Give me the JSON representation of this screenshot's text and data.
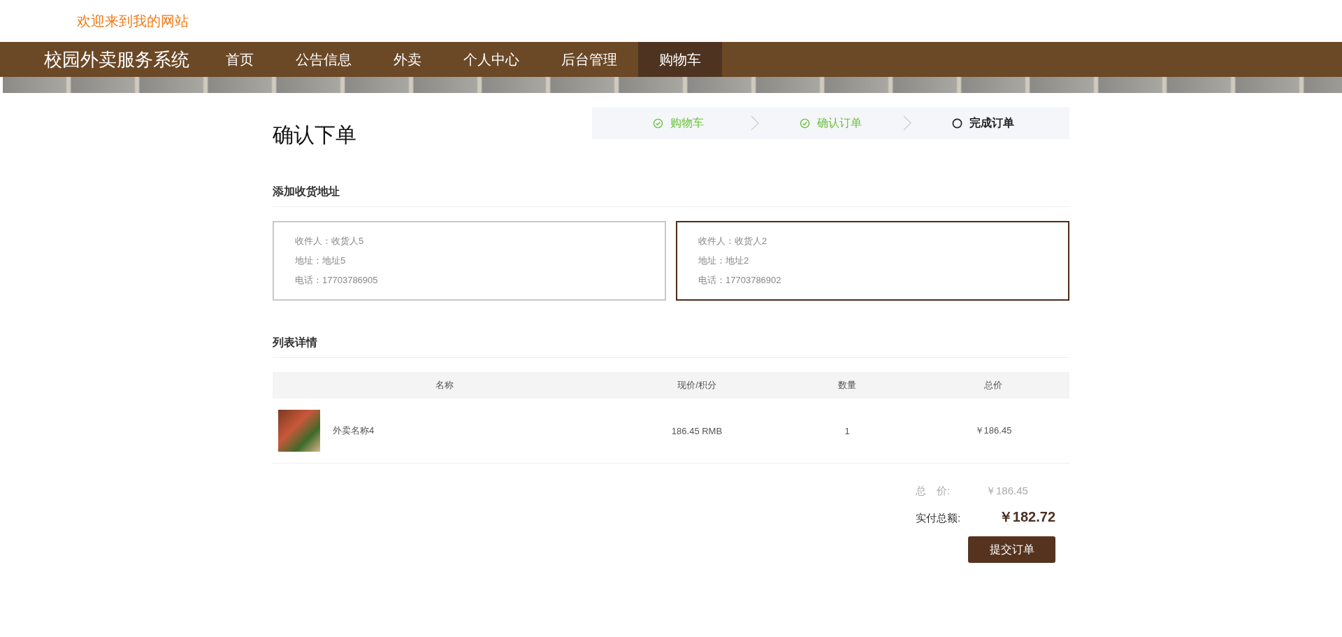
{
  "welcome": "欢迎来到我的网站",
  "nav": {
    "brand": "校园外卖服务系统",
    "items": [
      {
        "label": "首页",
        "selected": false
      },
      {
        "label": "公告信息",
        "selected": false
      },
      {
        "label": "外卖",
        "selected": false
      },
      {
        "label": "个人中心",
        "selected": false
      },
      {
        "label": "后台管理",
        "selected": false
      },
      {
        "label": "购物车",
        "selected": true
      }
    ]
  },
  "page_title": "确认下单",
  "steps": [
    {
      "label": "购物车",
      "done": true
    },
    {
      "label": "确认订单",
      "done": true
    },
    {
      "label": "完成订单",
      "done": false
    }
  ],
  "address_section": {
    "title": "添加收货地址",
    "cards": [
      {
        "lines": [
          "收件人：收货人5",
          "地址：地址5",
          "电话：17703786905"
        ],
        "selected": false
      },
      {
        "lines": [
          "收件人：收货人2",
          "地址：地址2",
          "电话：17703786902"
        ],
        "selected": true
      }
    ]
  },
  "list_section": {
    "title": "列表详情",
    "columns": [
      "名称",
      "现价/积分",
      "数量",
      "总价"
    ],
    "rows": [
      {
        "name": "外卖名称4",
        "price": "186.45 RMB",
        "quantity": "1",
        "total": "￥186.45"
      }
    ]
  },
  "summary": {
    "total_label": "总　价:",
    "total_value": "￥186.45",
    "pay_label": "实付总额:",
    "pay_value": "￥182.72",
    "submit": "提交订单"
  }
}
